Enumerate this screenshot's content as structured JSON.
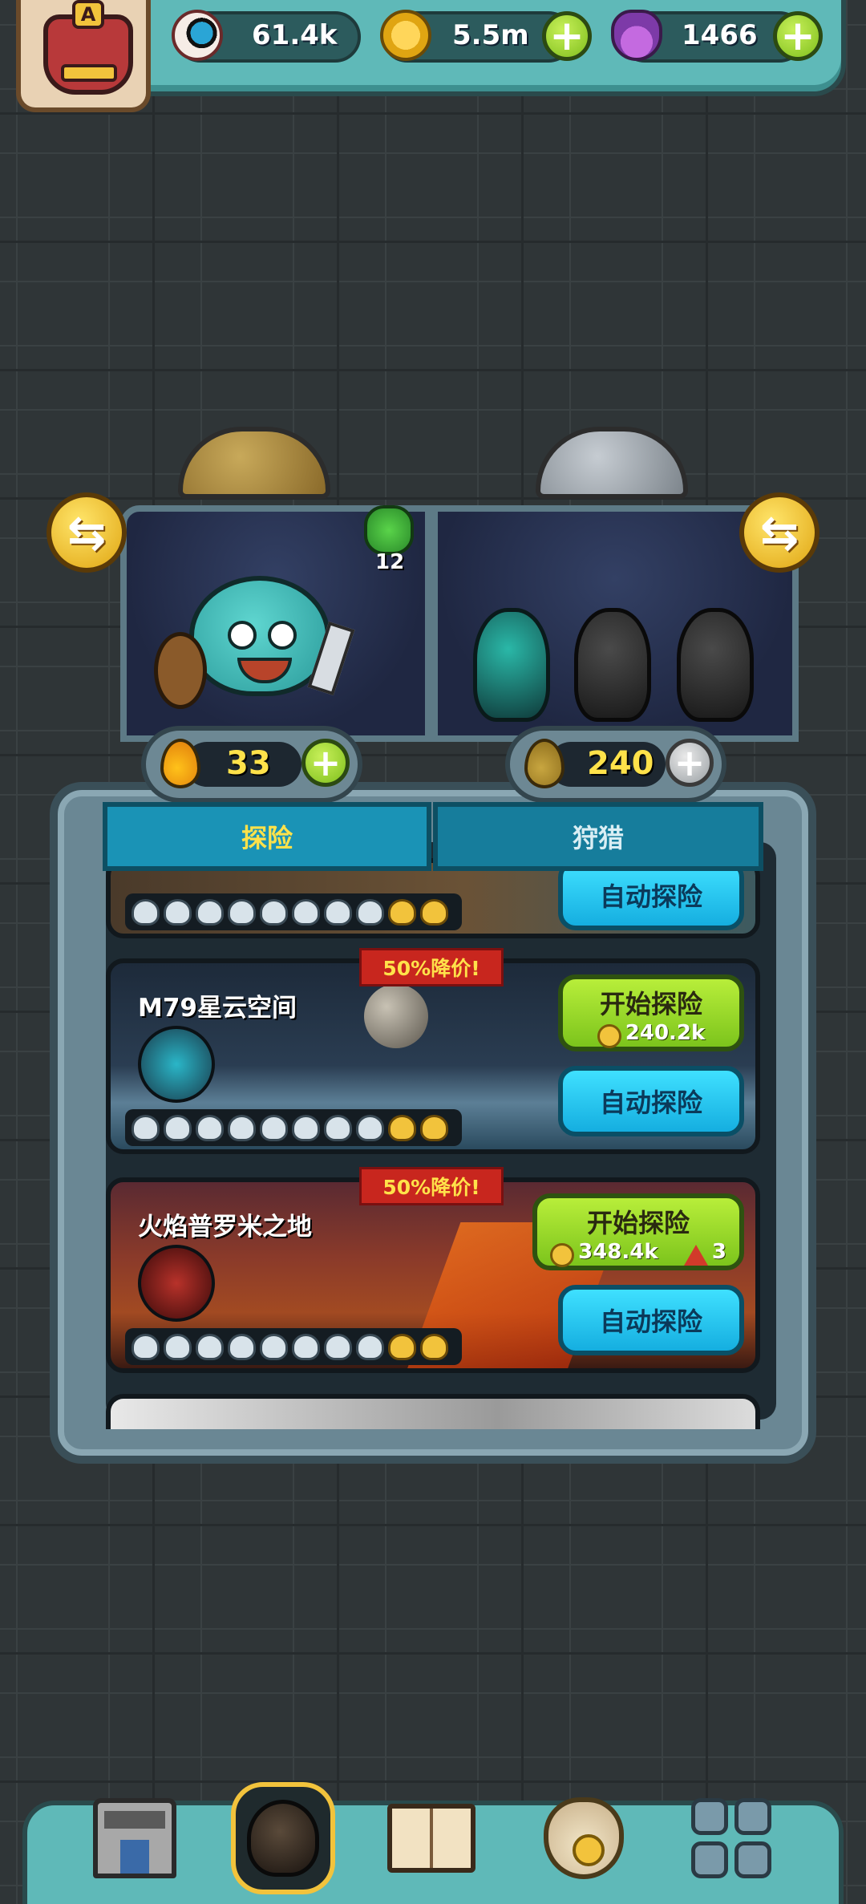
{
  "resources": {
    "eyeballs": "61.4k",
    "coins": "5.5m",
    "potions": "1466"
  },
  "player": {
    "rank_letter": "A"
  },
  "pods": {
    "clover_count": "12",
    "left_elixir": "33",
    "right_elixir": "240"
  },
  "tabs": [
    {
      "label": "探险",
      "active": true
    },
    {
      "label": "狩猎",
      "active": false
    }
  ],
  "buttons": {
    "start_label": "开始探险",
    "auto_label": "自动探险"
  },
  "levels": [
    {
      "name": "",
      "partial": true
    },
    {
      "name": "M79星云空间",
      "sale": "50%降价!",
      "cost_coins": "240.2k"
    },
    {
      "name": "火焰普罗米之地",
      "sale": "50%降价!",
      "cost_coins": "348.4k",
      "cost_gems": "3"
    }
  ],
  "colors": {
    "accent_green": "#8fd42a",
    "accent_blue": "#22c5ef",
    "sale_red": "#c8261e",
    "sale_text": "#ffe24a"
  },
  "icons": {
    "eyeball": "eyeball-icon",
    "coin": "coin-icon",
    "potion": "potion-icon",
    "clover": "clover-icon",
    "drop": "drop-icon"
  },
  "nav": [
    "shop-icon",
    "monster-icon",
    "book-icon",
    "money-bag-icon",
    "grid-icon"
  ]
}
